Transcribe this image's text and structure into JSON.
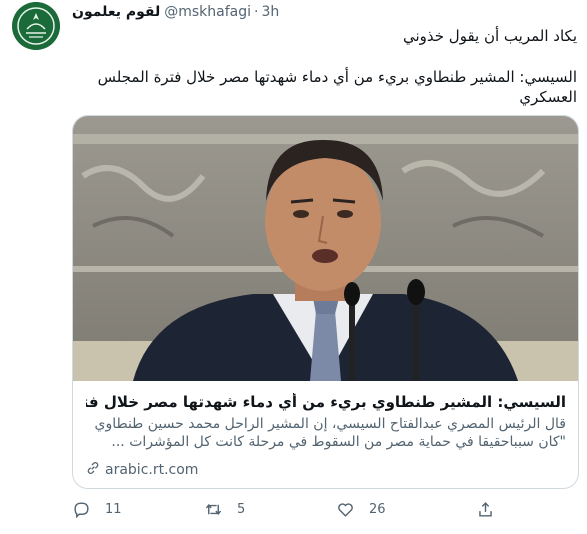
{
  "author": {
    "display_name": "لقوم يعلمون",
    "handle": "@mskhafagi",
    "separator": "·",
    "time": "3h"
  },
  "tweet": {
    "line1": "يكاد المريب أن يقول خذوني",
    "line2": "السيسي: المشير طنطاوي بريء من أي دماء شهدتها مصر خلال فترة المجلس العسكري"
  },
  "card": {
    "title": "السيسي: المشير طنطاوي بريء من أي دماء شهدتها مصر خلال فترة المجلس ا...",
    "description": "قال الرئيس المصري عبدالفتاح السيسي، إن المشير الراحل محمد حسين طنطاوي \"كان سبباحقيقا في حماية مصر من السقوط في مرحلة كانت كل المؤشرات ...",
    "domain": "arabic.rt.com",
    "link_icon": "link-icon",
    "image_icon": "news-photo"
  },
  "actions": {
    "reply": {
      "icon": "reply-icon",
      "count": "11"
    },
    "retweet": {
      "icon": "retweet-icon",
      "count": "5"
    },
    "like": {
      "icon": "heart-icon",
      "count": "26"
    },
    "share": {
      "icon": "share-icon"
    }
  },
  "colors": {
    "text": "#0f1419",
    "secondary": "#536471",
    "border": "#cfd9de",
    "avatar_bg": "#1b6b3a"
  }
}
